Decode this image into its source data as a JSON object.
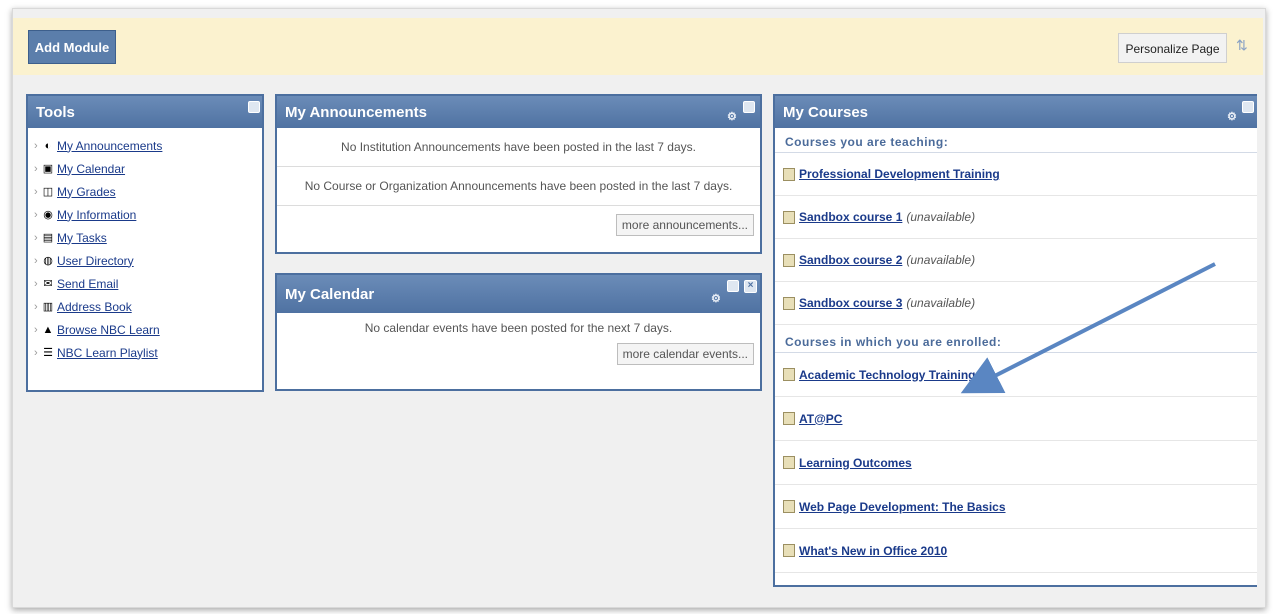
{
  "toolbar": {
    "add_module": "Add Module",
    "personalize": "Personalize Page"
  },
  "tools": {
    "title": "Tools",
    "items": [
      {
        "label": "My Announcements",
        "icon": "announcement-icon"
      },
      {
        "label": "My Calendar",
        "icon": "calendar-icon"
      },
      {
        "label": "My Grades",
        "icon": "grades-icon"
      },
      {
        "label": "My Information",
        "icon": "information-icon"
      },
      {
        "label": "My Tasks",
        "icon": "tasks-icon"
      },
      {
        "label": "User Directory",
        "icon": "directory-icon"
      },
      {
        "label": "Send Email",
        "icon": "email-icon"
      },
      {
        "label": "Address Book",
        "icon": "address-book-icon"
      },
      {
        "label": "Browse NBC Learn",
        "icon": "nbc-icon"
      },
      {
        "label": "NBC Learn Playlist",
        "icon": "playlist-icon"
      }
    ]
  },
  "announcements": {
    "title": "My Announcements",
    "institution": "No Institution Announcements have been posted in the last 7 days.",
    "course": "No Course or Organization Announcements have been posted in the last 7 days.",
    "more": "more announcements..."
  },
  "calendar": {
    "title": "My Calendar",
    "empty": "No calendar events have been posted for the next 7 days.",
    "more": "more calendar events..."
  },
  "courses": {
    "title": "My Courses",
    "teaching_heading": "Courses you are teaching:",
    "teaching": [
      {
        "name": "Professional Development Training",
        "status": ""
      },
      {
        "name": "Sandbox course 1",
        "status": "(unavailable)"
      },
      {
        "name": "Sandbox course 2",
        "status": "(unavailable)"
      },
      {
        "name": "Sandbox course 3",
        "status": "(unavailable)"
      }
    ],
    "enrolled_heading": "Courses in which you are enrolled:",
    "enrolled": [
      {
        "name": "Academic Technology Training"
      },
      {
        "name": "AT@PC"
      },
      {
        "name": "Learning Outcomes"
      },
      {
        "name": "Web Page Development: The Basics"
      },
      {
        "name": "What's New in Office 2010"
      }
    ]
  },
  "colors": {
    "header": "#5377a6",
    "accent_bar": "#fbf2cf",
    "link": "#1a3a8a",
    "arrow": "#5a86c2"
  }
}
